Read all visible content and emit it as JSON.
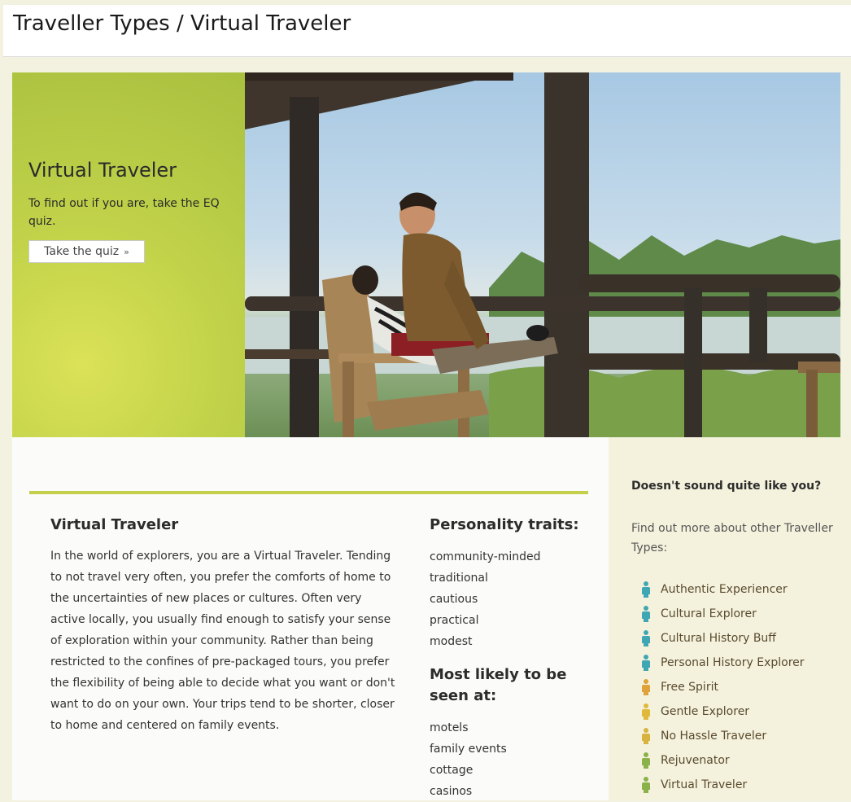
{
  "header": {
    "title": "Traveller Types / Virtual Traveler"
  },
  "hero": {
    "title": "Virtual Traveler",
    "subtitle": "To find out if you are, take the EQ quiz.",
    "quiz_button": "Take the quiz",
    "quiz_arrow": "»"
  },
  "main": {
    "title": "Virtual Traveler",
    "body": "In the world of explorers, you are a Virtual Traveler. Tending to not travel very often, you prefer the comforts of home to the uncertainties of new places or cultures. Often very active locally, you usually find enough to satisfy your sense of exploration within your community. Rather than being restricted to the confines of pre-packaged tours, you prefer the flexibility of being able to decide what you want or don't want to do on your own. Your trips tend to be shorter, closer to home and centered on family events.",
    "traits_title": "Personality traits:",
    "traits": [
      "community-minded",
      "traditional",
      "cautious",
      "practical",
      "modest"
    ],
    "seen_title": "Most likely to be seen at:",
    "seen": [
      "motels",
      "family events",
      "cottage",
      "casinos"
    ]
  },
  "sidebar": {
    "question": "Doesn't sound quite like you?",
    "find_more": "Find out more about other Traveller Types:",
    "types": [
      {
        "label": "Authentic Experiencer",
        "color": "#3fa7b3"
      },
      {
        "label": "Cultural Explorer",
        "color": "#3fa7b3"
      },
      {
        "label": "Cultural History Buff",
        "color": "#3fa7b3"
      },
      {
        "label": "Personal History Explorer",
        "color": "#3fa7b3"
      },
      {
        "label": "Free Spirit",
        "color": "#e0a23a"
      },
      {
        "label": "Gentle Explorer",
        "color": "#e0b83a"
      },
      {
        "label": "No Hassle Traveler",
        "color": "#d9b33f"
      },
      {
        "label": "Rejuvenator",
        "color": "#8bb14a"
      },
      {
        "label": "Virtual Traveler",
        "color": "#8bb14a"
      }
    ]
  },
  "colors": {
    "accent_green": "#c4cf4b",
    "sidebar_bg": "#f4f2dd"
  }
}
